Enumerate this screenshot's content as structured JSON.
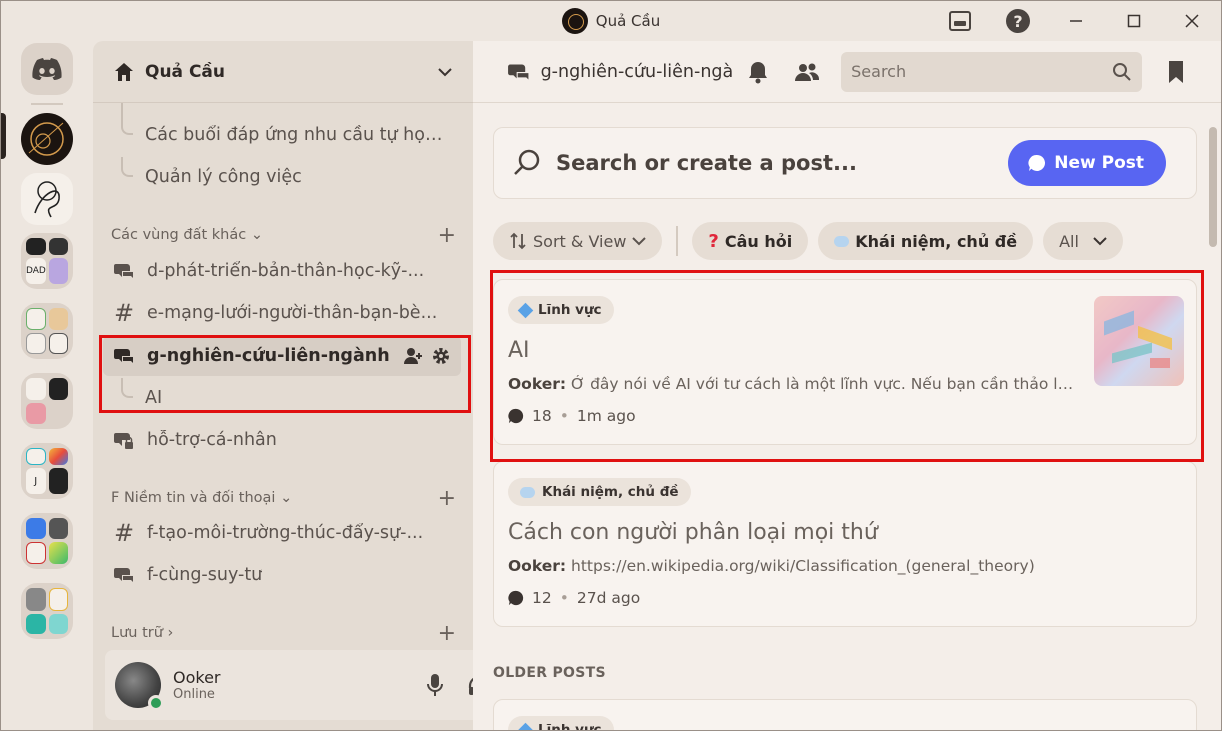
{
  "window": {
    "title": "Quả Cầu"
  },
  "server": {
    "name": "Quả Cầu"
  },
  "sidebar": {
    "threads_top": [
      "Các buổi đáp ứng nhu cầu tự học l...",
      "Quản lý công việc"
    ],
    "category_1": "Các vùng đất khác",
    "channels_1": [
      "d-phát-triển-bản-thân-học-kỹ-...",
      "e-mạng-lưới-người-thân-bạn-bè...",
      "g-nghiên-cứu-liên-ngành",
      "hỗ-trợ-cá-nhân"
    ],
    "thread_ai": "AI",
    "category_2": "F Niềm tin và đối thoại",
    "channels_2": [
      "f-tạo-môi-trường-thúc-đẩy-sự-...",
      "f-cùng-suy-tư"
    ],
    "category_3": "Lưu trữ"
  },
  "user": {
    "name": "Ooker",
    "status": "Online"
  },
  "header": {
    "channel": "g-nghiên-cứu-liên-ngành",
    "search_placeholder": "Search"
  },
  "forum": {
    "create_placeholder": "Search or create a post...",
    "new_post": "New Post",
    "sort_view": "Sort & View",
    "tag_question": "Câu hỏi",
    "tag_concept": "Khái niệm, chủ đề",
    "all": "All",
    "older_posts": "OLDER POSTS",
    "posts": [
      {
        "tag": "Lĩnh vực",
        "title": "AI",
        "author": "Ooker:",
        "excerpt": "Ở đây nói về AI với tư cách là một lĩnh vực. Nếu bạn cần thảo luận n...",
        "replies": "18",
        "time": "1m ago"
      },
      {
        "tag": "Khái niệm, chủ đề",
        "title": "Cách con người phân loại mọi thứ",
        "author": "Ooker:",
        "excerpt": "https://en.wikipedia.org/wiki/Classification_(general_theory)",
        "replies": "12",
        "time": "27d ago"
      }
    ],
    "partial_tag": "Lĩnh vực"
  },
  "colors": {
    "accent": "#5865f2",
    "highlight": "#e01010",
    "online": "#2e9d57"
  }
}
